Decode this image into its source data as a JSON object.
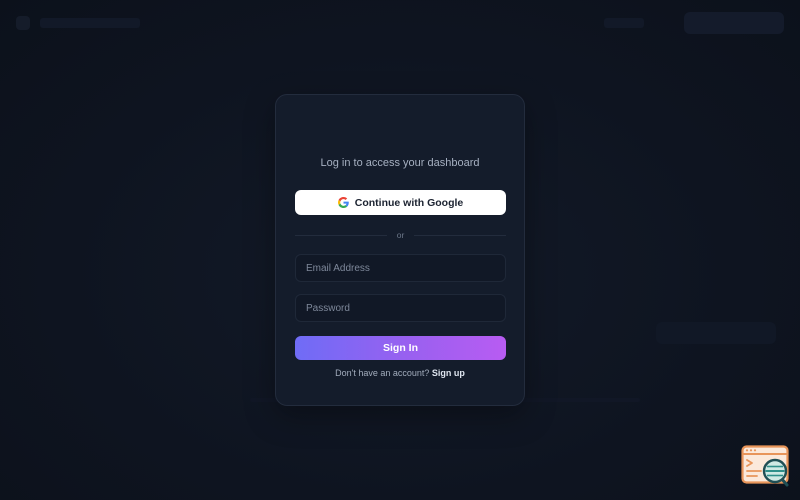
{
  "login": {
    "subtitle": "Log in to access your dashboard",
    "google_button_label": "Continue with Google",
    "divider_text": "or",
    "email_placeholder": "Email Address",
    "password_placeholder": "Password",
    "sign_in_label": "Sign In",
    "signup_prompt": "Don't have an account?",
    "signup_link": "Sign up"
  },
  "icons": {
    "google": "google-g-icon",
    "helper": "terminal-search-icon"
  },
  "colors": {
    "background": "#0e1420",
    "card": "#141c2b",
    "accent_start": "#6f6cf6",
    "accent_end": "#b85cf2",
    "helper_orange": "#e8955a",
    "helper_teal": "#2f8f8a"
  }
}
